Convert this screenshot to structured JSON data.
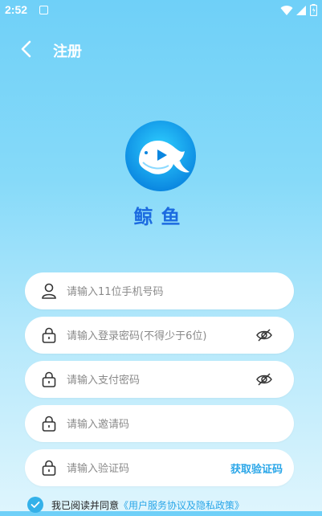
{
  "status": {
    "time": "2:52"
  },
  "nav": {
    "title": "注册"
  },
  "brand": {
    "name": "鲸鱼"
  },
  "fields": {
    "phone_placeholder": "请输入11位手机号码",
    "login_password_placeholder": "请输入登录密码(不得少于6位)",
    "pay_password_placeholder": "请输入支付密码",
    "invite_placeholder": "请输入邀请码",
    "code_placeholder": "请输入验证码",
    "get_code_label": "获取验证码"
  },
  "agreement": {
    "prefix": "我已阅读并同意",
    "link": "《用户服务协议及隐私政策》",
    "checked": true
  },
  "colors": {
    "accent": "#2aa6e8",
    "brand_text": "#1c6be0",
    "checkbox": "#34b1e9"
  }
}
